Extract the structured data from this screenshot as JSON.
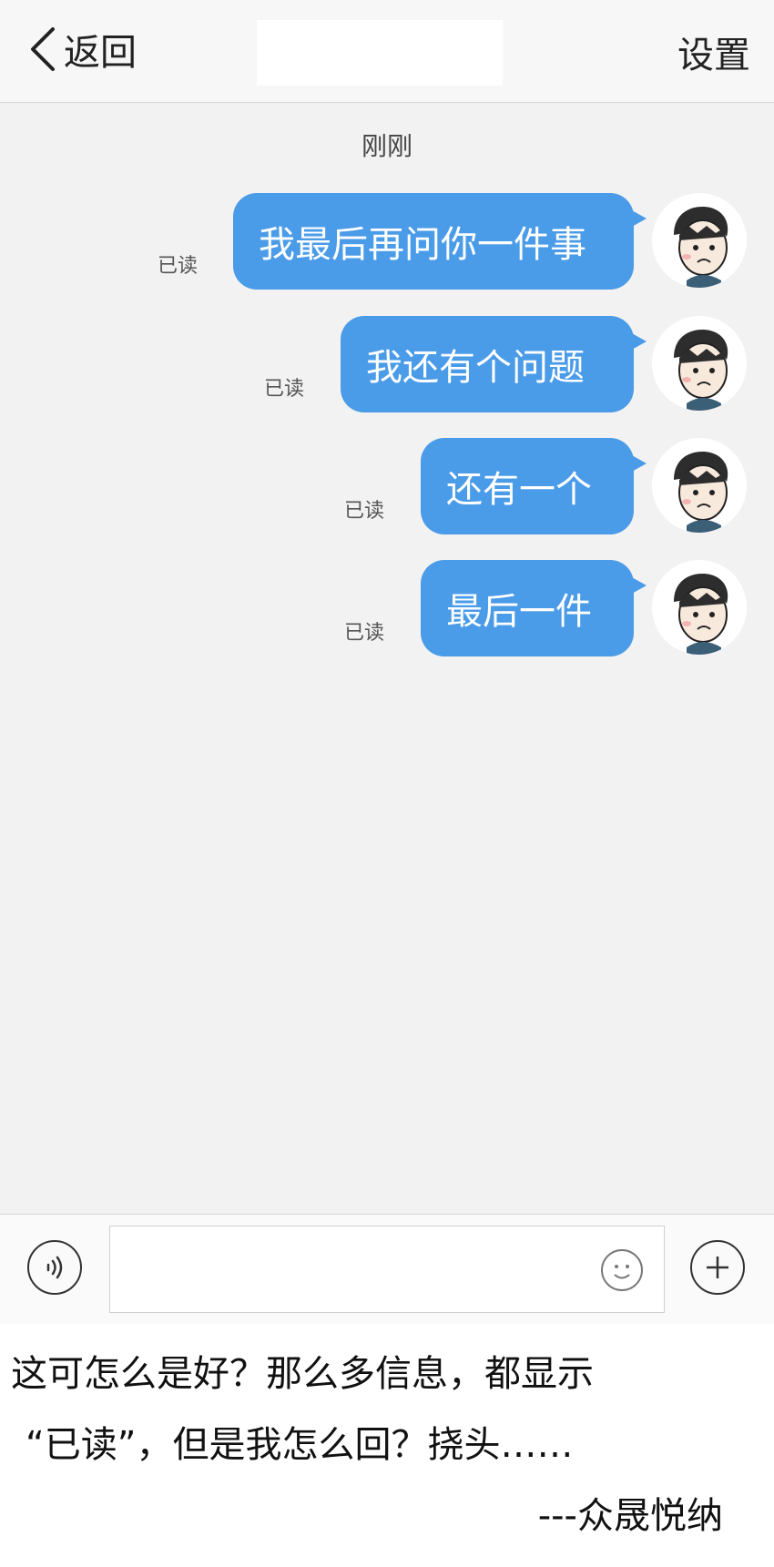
{
  "header": {
    "back_label": "返回",
    "settings_label": "设置"
  },
  "chat": {
    "timestamp": "刚刚",
    "messages": [
      {
        "text": "我最后再问你一件事",
        "status": "已读"
      },
      {
        "text": "我还有个问题",
        "status": "已读"
      },
      {
        "text": "还有一个",
        "status": "已读"
      },
      {
        "text": "最后一件",
        "status": "已读"
      }
    ]
  },
  "input": {
    "value": "",
    "placeholder": ""
  },
  "caption": {
    "line1": "这可怎么是好？那么多信息，都显示",
    "line2": "“已读”，但是我怎么回？挠头……",
    "signature": "---众晟悦纳"
  },
  "colors": {
    "bubble": "#4a9be8",
    "chat_bg": "#f2f2f2",
    "header_bg": "#f7f7f7"
  },
  "icons": [
    "chevron-left-icon",
    "avatar",
    "voice-icon",
    "emoji-icon",
    "plus-icon"
  ]
}
